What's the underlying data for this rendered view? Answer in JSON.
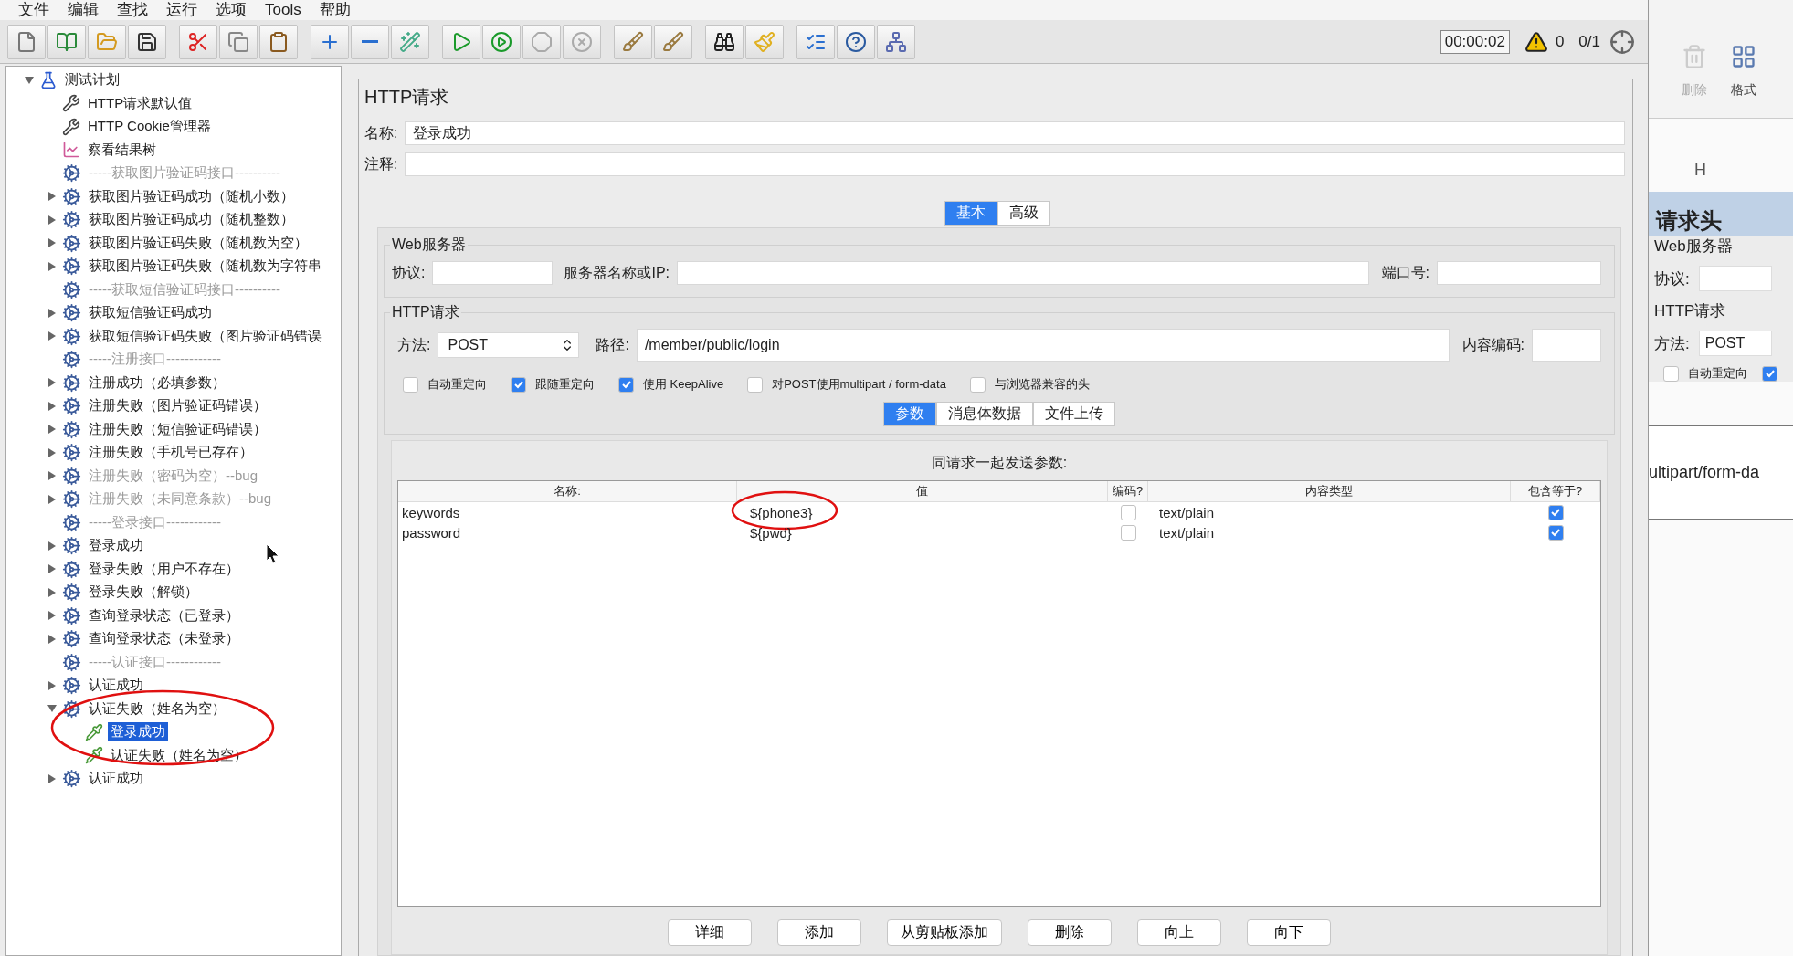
{
  "menu": [
    "文件",
    "编辑",
    "查找",
    "运行",
    "选项",
    "Tools",
    "帮助"
  ],
  "status": {
    "timer": "00:00:02",
    "warnings": "0",
    "threads": "0/1"
  },
  "tree": {
    "label": "测试计划",
    "kind": "plan",
    "expanded": true,
    "selected": false,
    "disabled": false,
    "children": [
      {
        "label": "HTTP请求默认值",
        "kind": "config",
        "selected": false,
        "disabled": false
      },
      {
        "label": "HTTP Cookie管理器",
        "kind": "config",
        "selected": false,
        "disabled": false
      },
      {
        "label": "察看结果树",
        "kind": "listener",
        "selected": false,
        "disabled": false
      },
      {
        "label": "-----获取图片验证码接口----------",
        "kind": "controller",
        "selected": false,
        "disabled": true
      },
      {
        "label": "获取图片验证码成功（随机小数）",
        "kind": "controller",
        "expanded": false,
        "selected": false,
        "disabled": false
      },
      {
        "label": "获取图片验证码成功（随机整数）",
        "kind": "controller",
        "expanded": false,
        "selected": false,
        "disabled": false
      },
      {
        "label": "获取图片验证码失败（随机数为空）",
        "kind": "controller",
        "expanded": false,
        "selected": false,
        "disabled": false
      },
      {
        "label": "获取图片验证码失败（随机数为字符串",
        "kind": "controller",
        "expanded": false,
        "selected": false,
        "disabled": false
      },
      {
        "label": "-----获取短信验证码接口----------",
        "kind": "controller",
        "selected": false,
        "disabled": true
      },
      {
        "label": "获取短信验证码成功",
        "kind": "controller",
        "expanded": false,
        "selected": false,
        "disabled": false
      },
      {
        "label": "获取短信验证码失败（图片验证码错误",
        "kind": "controller",
        "expanded": false,
        "selected": false,
        "disabled": false
      },
      {
        "label": "-----注册接口------------",
        "kind": "controller",
        "selected": false,
        "disabled": true
      },
      {
        "label": "注册成功（必填参数）",
        "kind": "controller",
        "expanded": false,
        "selected": false,
        "disabled": false
      },
      {
        "label": "注册失败（图片验证码错误）",
        "kind": "controller",
        "expanded": false,
        "selected": false,
        "disabled": false
      },
      {
        "label": "注册失败（短信验证码错误）",
        "kind": "controller",
        "expanded": false,
        "selected": false,
        "disabled": false
      },
      {
        "label": "注册失败（手机号已存在）",
        "kind": "controller",
        "expanded": false,
        "selected": false,
        "disabled": false
      },
      {
        "label": "注册失败（密码为空）--bug",
        "kind": "controller",
        "expanded": false,
        "selected": false,
        "disabled": true
      },
      {
        "label": "注册失败（未同意条款）--bug",
        "kind": "controller",
        "expanded": false,
        "selected": false,
        "disabled": true
      },
      {
        "label": "-----登录接口------------",
        "kind": "controller",
        "selected": false,
        "disabled": true
      },
      {
        "label": "登录成功",
        "kind": "controller",
        "expanded": false,
        "selected": false,
        "disabled": false
      },
      {
        "label": "登录失败（用户不存在）",
        "kind": "controller",
        "expanded": false,
        "selected": false,
        "disabled": false
      },
      {
        "label": "登录失败（解锁）",
        "kind": "controller",
        "expanded": false,
        "selected": false,
        "disabled": false
      },
      {
        "label": "查询登录状态（已登录）",
        "kind": "controller",
        "expanded": false,
        "selected": false,
        "disabled": false
      },
      {
        "label": "查询登录状态（未登录）",
        "kind": "controller",
        "expanded": false,
        "selected": false,
        "disabled": false
      },
      {
        "label": "-----认证接口------------",
        "kind": "controller",
        "selected": false,
        "disabled": true
      },
      {
        "label": "认证成功",
        "kind": "controller",
        "expanded": false,
        "selected": false,
        "disabled": false
      },
      {
        "label": "认证失败（姓名为空）",
        "kind": "controller",
        "expanded": true,
        "selected": false,
        "disabled": false,
        "children": [
          {
            "label": "登录成功",
            "kind": "sampler",
            "selected": true,
            "disabled": false
          },
          {
            "label": "认证失败（姓名为空）",
            "kind": "sampler",
            "selected": false,
            "disabled": false
          }
        ]
      },
      {
        "label": "认证成功",
        "kind": "controller",
        "expanded": false,
        "selected": false,
        "disabled": false
      }
    ]
  },
  "form": {
    "title": "HTTP请求",
    "name_label": "名称:",
    "name": "登录成功",
    "comment_label": "注释:",
    "tabs": [
      {
        "label": "基本",
        "selected": true
      },
      {
        "label": "高级",
        "selected": false
      }
    ],
    "web_server": {
      "title": "Web服务器",
      "protocol_label": "协议:",
      "server_label": "服务器名称或IP:",
      "port_label": "端口号:"
    },
    "http_request": {
      "title": "HTTP请求",
      "method_label": "方法:",
      "method": "POST",
      "path_label": "路径:",
      "path": "/member/public/login",
      "encoding_label": "内容编码:"
    },
    "options": [
      {
        "label": "自动重定向",
        "checked": false
      },
      {
        "label": "跟随重定向",
        "checked": true
      },
      {
        "label": "使用 KeepAlive",
        "checked": true
      },
      {
        "label": "对POST使用multipart / form-data",
        "checked": false
      },
      {
        "label": "与浏览器兼容的头",
        "checked": false
      }
    ],
    "subtabs": [
      {
        "label": "参数",
        "selected": true
      },
      {
        "label": "消息体数据",
        "selected": false
      },
      {
        "label": "文件上传",
        "selected": false
      }
    ],
    "params": {
      "caption": "同请求一起发送参数:",
      "columns": [
        "名称:",
        "值",
        "编码?",
        "内容类型",
        "包含等于?"
      ],
      "rows": [
        {
          "name": "keywords",
          "value": "${phone3}",
          "encode": false,
          "content_type": "text/plain",
          "include_equals": true
        },
        {
          "name": "password",
          "value": "${pwd}",
          "encode": false,
          "content_type": "text/plain",
          "include_equals": true
        }
      ]
    },
    "buttons": [
      "详细",
      "添加",
      "从剪贴板添加",
      "删除",
      "向上",
      "向下"
    ]
  },
  "background_window": {
    "toolbar": [
      {
        "label": "删除",
        "disabled": true
      },
      {
        "label": "格式",
        "disabled": false
      }
    ],
    "tab_letter": "H",
    "header": "请求头",
    "group": "Web服务器",
    "protocol_label": "协议:",
    "http_group": "HTTP请求",
    "method_label": "方法:",
    "method": "POST",
    "checkboxes": [
      {
        "label": "自动重定向",
        "checked": false
      },
      {
        "checked": true
      }
    ],
    "text": "ultipart/form-da"
  }
}
